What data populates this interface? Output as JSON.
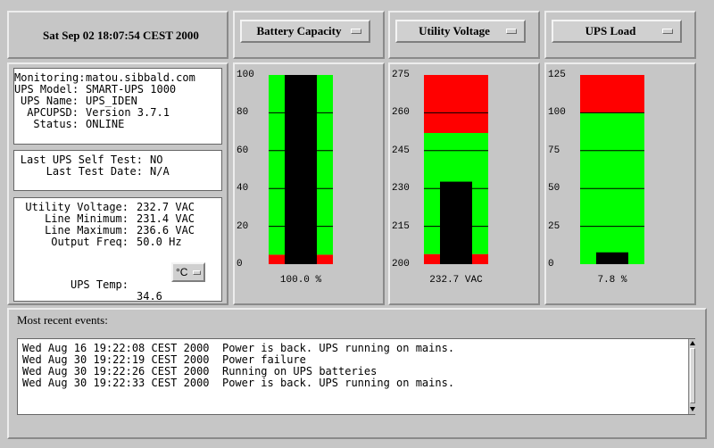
{
  "header": {
    "date": "Sat Sep 02 18:07:54 CEST 2000"
  },
  "info": {
    "rows": [
      {
        "key": "Monitoring:",
        "value": "matou.sibbald.com"
      },
      {
        "key": "UPS Model:",
        "value": "SMART-UPS 1000"
      },
      {
        "key": "UPS Name:",
        "value": "UPS_IDEN"
      },
      {
        "key": "APCUPSD:",
        "value": "Version 3.7.1"
      },
      {
        "key": "Status:",
        "value": "ONLINE"
      }
    ]
  },
  "selftest": {
    "rows": [
      {
        "key": "Last UPS Self Test:",
        "value": "NO"
      },
      {
        "key": "Last Test Date:",
        "value": "N/A"
      }
    ]
  },
  "voltage": {
    "rows": [
      {
        "key": "Utility Voltage:",
        "value": "232.7 VAC"
      },
      {
        "key": "Line Minimum:",
        "value": "231.4 VAC"
      },
      {
        "key": "Line Maximum:",
        "value": "236.6 VAC"
      },
      {
        "key": "Output Freq:",
        "value": "50.0 Hz"
      }
    ],
    "temp_label": "UPS Temp:",
    "temp_value": "34.6",
    "temp_unit": "°C"
  },
  "gauges": [
    {
      "title": "Battery Capacity",
      "ticks": [
        "100",
        "80",
        "60",
        "40",
        "20",
        "0"
      ],
      "min": 0,
      "max": 100,
      "value": 100,
      "zones": [
        {
          "from": 0,
          "to": 5,
          "color": "#ff0000"
        },
        {
          "from": 5,
          "to": 100,
          "color": "#00ff00"
        }
      ],
      "display": "100.0 %"
    },
    {
      "title": "Utility Voltage",
      "ticks": [
        "275",
        "260",
        "245",
        "230",
        "215",
        "200"
      ],
      "min": 200,
      "max": 275,
      "value": 232.7,
      "zones": [
        {
          "from": 200,
          "to": 204,
          "color": "#ff0000"
        },
        {
          "from": 204,
          "to": 252,
          "color": "#00ff00"
        },
        {
          "from": 252,
          "to": 275,
          "color": "#ff0000"
        }
      ],
      "display": "232.7 VAC"
    },
    {
      "title": "UPS Load",
      "ticks": [
        "125",
        "100",
        "75",
        "50",
        "25",
        "0"
      ],
      "min": 0,
      "max": 125,
      "value": 7.8,
      "zones": [
        {
          "from": 0,
          "to": 100,
          "color": "#00ff00"
        },
        {
          "from": 100,
          "to": 125,
          "color": "#ff0000"
        }
      ],
      "display": "7.8 %"
    }
  ],
  "events": {
    "title": "Most recent events:",
    "lines": [
      "Wed Aug 16 19:22:08 CEST 2000  Power is back. UPS running on mains.",
      "Wed Aug 30 19:22:19 CEST 2000  Power failure",
      "Wed Aug 30 19:22:26 CEST 2000  Running on UPS batteries",
      "Wed Aug 30 19:22:33 CEST 2000  Power is back. UPS running on mains."
    ]
  },
  "colors": {
    "bar": "#000000",
    "gridline": "#000000"
  }
}
